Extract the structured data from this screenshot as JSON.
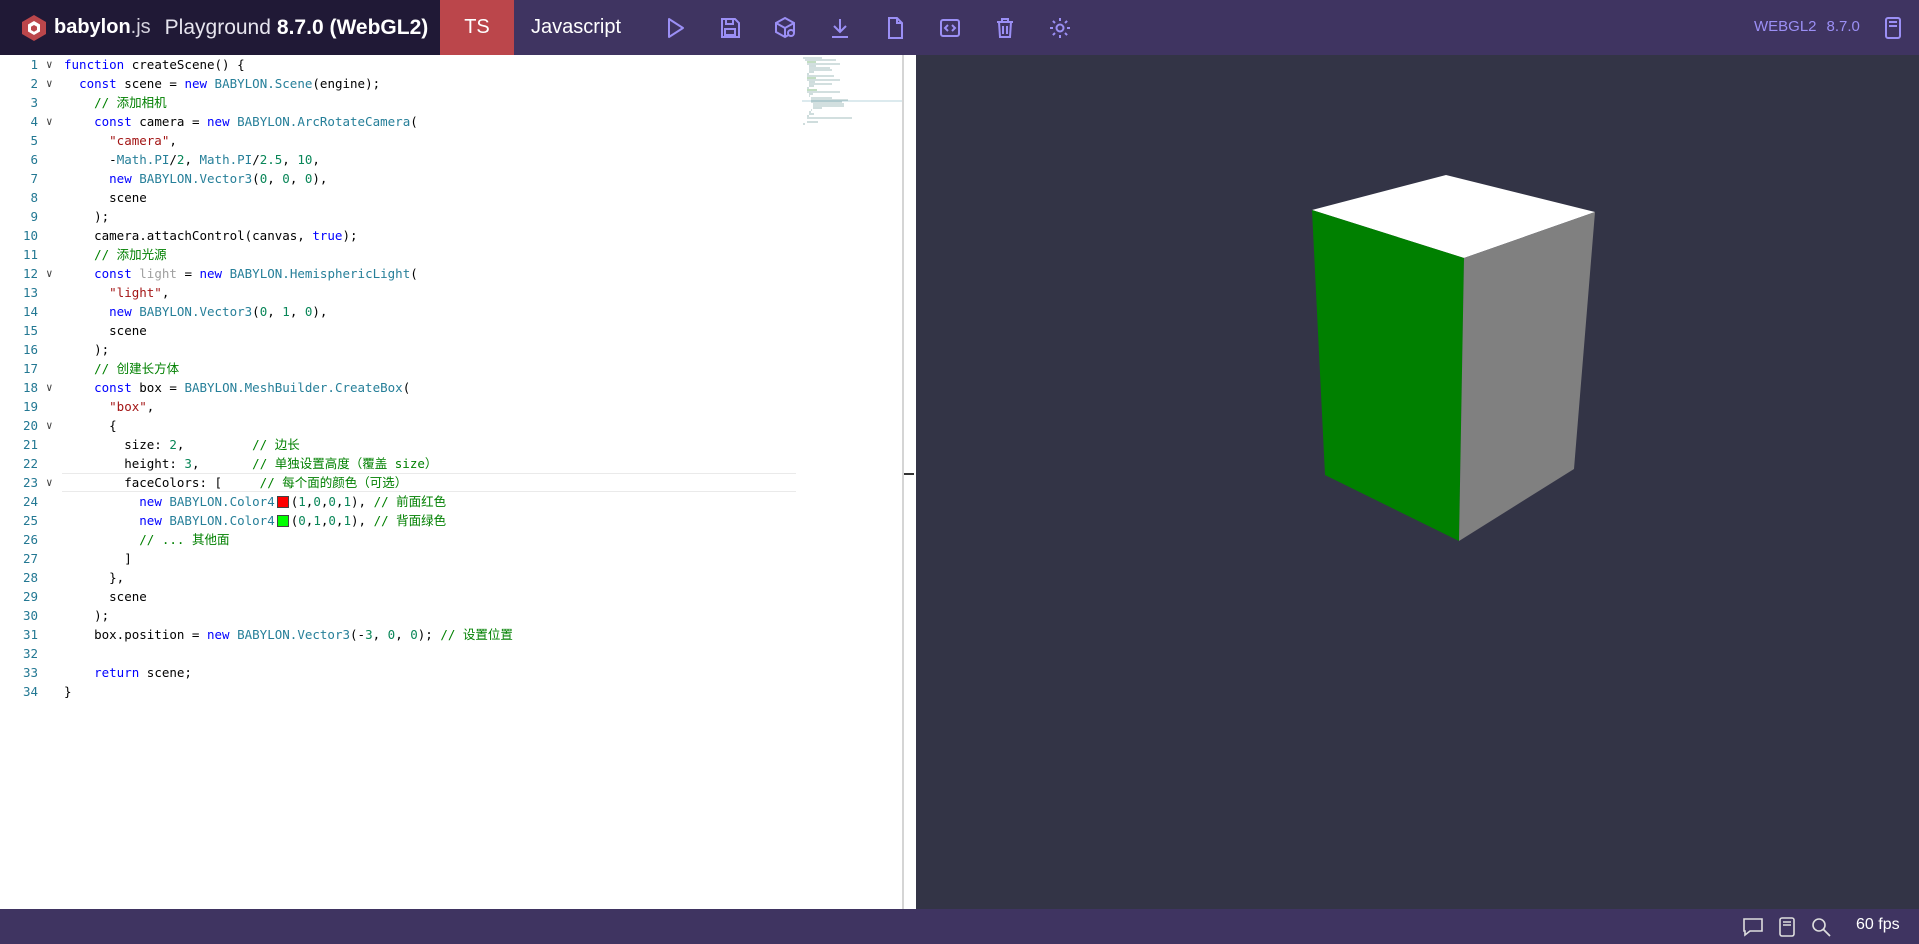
{
  "header": {
    "brand_name": "babylon",
    "brand_ext": ".js",
    "title": "Playground",
    "version": "8.7.0 (WebGL2)",
    "tabs": [
      {
        "label": "TS",
        "active": true
      },
      {
        "label": "Javascript",
        "active": false
      }
    ],
    "tools": [
      "run-icon",
      "save-icon",
      "inspector-icon",
      "download-icon",
      "new-file-icon",
      "code-format-icon",
      "clear-icon",
      "settings-icon"
    ],
    "engine": "WEBGL2",
    "engine_version": "8.7.0",
    "accent": "#bb464b",
    "background": "#3f3461"
  },
  "editor": {
    "lines": [
      "function createScene() {",
      "  const scene = new BABYLON.Scene(engine);",
      "    // 添加相机",
      "    const camera = new BABYLON.ArcRotateCamera(",
      "      \"camera\",",
      "      -Math.PI/2, Math.PI/2.5, 10,",
      "      new BABYLON.Vector3(0, 0, 0),",
      "      scene",
      "    );",
      "    camera.attachControl(canvas, true);",
      "    // 添加光源",
      "    const light = new BABYLON.HemisphericLight(",
      "      \"light\",",
      "      new BABYLON.Vector3(0, 1, 0),",
      "      scene",
      "    );",
      "    // 创建长方体",
      "    const box = BABYLON.MeshBuilder.CreateBox(",
      "      \"box\",",
      "      {",
      "        size: 2,         // 边长",
      "        height: 3,       // 单独设置高度（覆盖 size）",
      "        faceColors: [     // 每个面的颜色（可选）",
      "          new BABYLON.Color4(1,0,0,1), // 前面红色",
      "          new BABYLON.Color4(0,1,0,1), // 背面绿色",
      "          // ... 其他面",
      "        ]",
      "      },",
      "      scene",
      "    );",
      "    box.position = new BABYLON.Vector3(-3, 0, 0); // 设置位置",
      "",
      "    return scene;",
      "}"
    ],
    "fold_lines": [
      1,
      2,
      4,
      12,
      18,
      20,
      23
    ],
    "swatch_red": "#ff0000",
    "swatch_green": "#00ff00"
  },
  "scene": {
    "background": "#333446",
    "cube_top": "#ffffff",
    "cube_left": "#008000",
    "cube_right": "#808080"
  },
  "footer": {
    "icons": [
      "chat-icon",
      "docs-icon",
      "search-icon"
    ],
    "fps": "60 fps"
  }
}
